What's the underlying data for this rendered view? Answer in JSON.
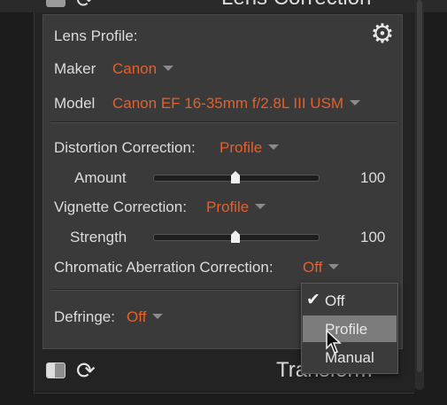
{
  "top_header": {
    "title": "Lens Correction"
  },
  "lens_profile": {
    "heading": "Lens Profile:",
    "maker_label": "Maker",
    "maker_value": "Canon",
    "model_label": "Model",
    "model_value": "Canon EF 16-35mm f/2.8L III USM"
  },
  "distortion": {
    "label": "Distortion Correction:",
    "value": "Profile",
    "amount_label": "Amount",
    "amount_value": "100",
    "amount_level": 0.5
  },
  "vignette": {
    "label": "Vignette Correction:",
    "value": "Profile",
    "strength_label": "Strength",
    "strength_value": "100",
    "strength_level": 0.5
  },
  "chromatic": {
    "label": "Chromatic Aberration Correction:",
    "value": "Off"
  },
  "defringe": {
    "label": "Defringe:",
    "value": "Off"
  },
  "dropdown": {
    "options": [
      "Off",
      "Profile",
      "Manual"
    ],
    "selected": "Off",
    "hovered": "Profile"
  },
  "bottom_bar": {
    "title": "Transform"
  },
  "colors": {
    "accent": "#e2612c",
    "panel": "#3a3a3a",
    "background": "#1c1c1c",
    "highlight": "#7c7c7c"
  }
}
